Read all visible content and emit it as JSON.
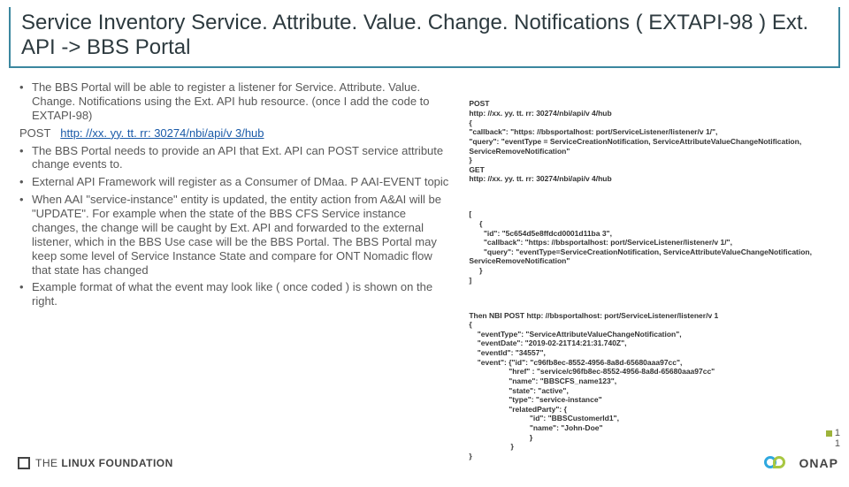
{
  "title": "Service Inventory Service. Attribute. Value. Change. Notifications  ( EXTAPI-98 ) Ext. API -> BBS Portal",
  "left": {
    "b1": "The BBS Portal will be able to register a listener for Service. Attribute. Value. Change. Notifications using the Ext. API hub resource. (once I add the code to EXTAPI-98)",
    "post_label": "POST",
    "post_link": "http: //xx. yy. tt. rr: 30274/nbi/api/v 3/hub",
    "b2": "The BBS Portal needs to provide an API that Ext. API can POST service attribute change events to.",
    "b3": "External API Framework will register as a Consumer of DMaa. P AAI-EVENT topic",
    "b4": "When AAI \"service-instance\" entity is updated, the entity action from A&AI will be \"UPDATE\". For example when the state of the BBS CFS Service instance changes, the change will be caught by Ext. API and forwarded to the external listener, which in the BBS Use case will be the BBS Portal. The BBS Portal may keep some level of Service Instance State and compare for ONT Nomadic flow that state has changed",
    "b5": "Example format of what the event may look like ( once coded ) is shown on the right."
  },
  "right": {
    "block1": "POST\nhttp: //xx. yy. tt. rr: 30274/nbi/api/v 4/hub\n{\n\"callback\": \"https: //bbsportalhost: port/ServiceListener/listener/v 1/\",\n\"query\": \"eventType = ServiceCreationNotification, ServiceAttributeValueChangeNotification, ServiceRemoveNotification\"\n}\nGET\nhttp: //xx. yy. tt. rr: 30274/nbi/api/v 4/hub",
    "block2": "[\n     {\n       \"id\": \"5c654d5e8ffdcd0001d11ba 3\",\n       \"callback\": \"https: //bbsportalhost: port/ServiceListener/listener/v 1/\",\n       \"query\": \"eventType=ServiceCreationNotification, ServiceAttributeValueChangeNotification, ServiceRemoveNotification\"\n     }\n]",
    "block3": "Then NBI POST http: //bbsportalhost: port/ServiceListener/listener/v 1\n{\n    \"eventType\": \"ServiceAttributeValueChangeNotification\",\n    \"eventDate\": \"2019-02-21T14:21:31.740Z\",\n    \"eventId\": \"34557\",\n    \"event\": {\"id\": \"c96fb8ec-8552-4956-8a8d-65680aaa97cc\",\n                   \"href\" : \"service/c96fb8ec-8552-4956-8a8d-65680aaa97cc\"\n                   \"name\": \"BBSCFS_name123\",\n                   \"state\": \"active\",\n                   \"type\": \"service-instance\"\n                   \"relatedParty\": {\n                             \"id\": \"BBSCustomerId1\",\n                             \"name\": \"John-Doe\"\n                             }\n                    }\n}"
  },
  "page": {
    "bullet_num": "1",
    "plain_num": "1"
  },
  "footer": {
    "lf": "THE LINUX FOUNDATION",
    "lf_prefix": "THE",
    "lf_main": "LINUX FOUNDATION",
    "onap": "ONAP"
  }
}
